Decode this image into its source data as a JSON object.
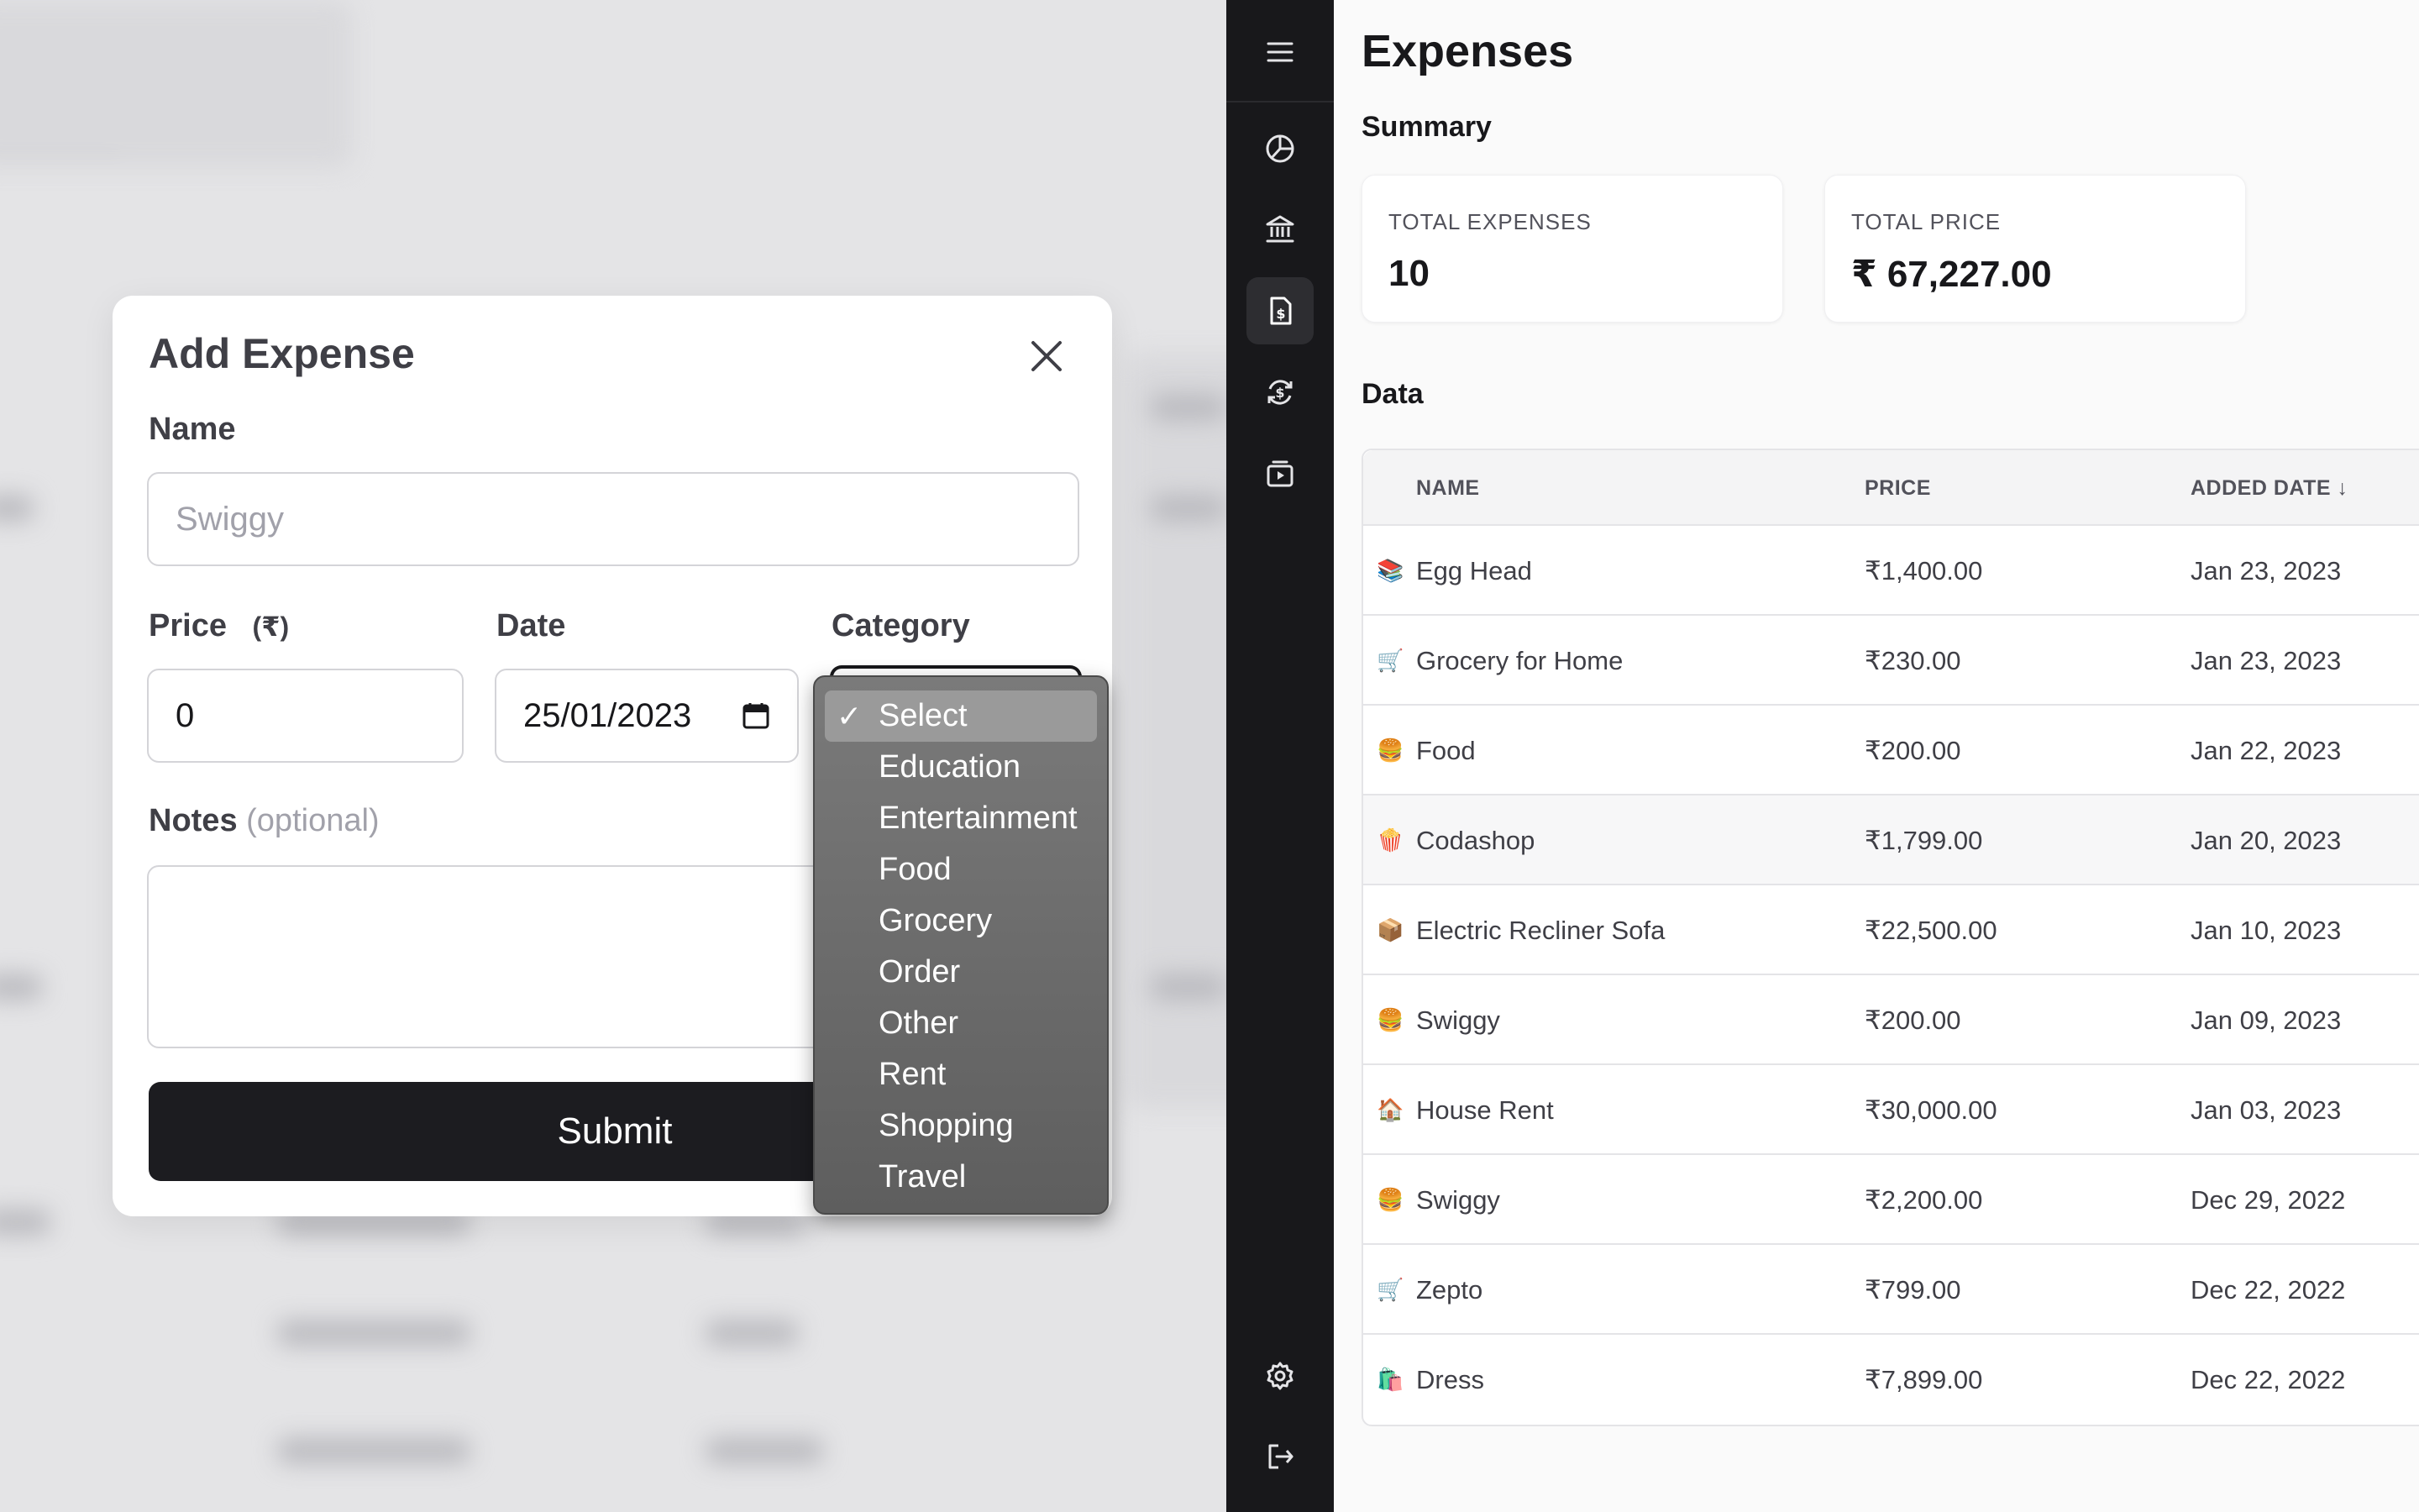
{
  "modal": {
    "title": "Add Expense",
    "name_label": "Name",
    "name_placeholder": "Swiggy",
    "price_label": "Price",
    "price_unit": "(₹)",
    "price_value": "0",
    "date_label": "Date",
    "date_value": "25/01/2023",
    "category_label": "Category",
    "notes_label": "Notes",
    "notes_optional": "(optional)",
    "submit_label": "Submit"
  },
  "dropdown": {
    "check": "✓",
    "options": [
      "Select",
      "Education",
      "Entertainment",
      "Food",
      "Grocery",
      "Order",
      "Other",
      "Rent",
      "Shopping",
      "Travel"
    ]
  },
  "sidebar": {
    "icons": [
      "menu-icon",
      "pie-chart-icon",
      "bank-icon",
      "invoice-icon",
      "recurring-icon",
      "subscription-icon",
      "settings-icon",
      "logout-icon"
    ],
    "active": "invoice-icon"
  },
  "main": {
    "title": "Expenses",
    "summary_title": "Summary",
    "cards": [
      {
        "label": "TOTAL EXPENSES",
        "value": "10"
      },
      {
        "label": "TOTAL PRICE",
        "value": "₹ 67,227.00"
      }
    ],
    "data_title": "Data",
    "table": {
      "headers": {
        "name": "NAME",
        "price": "PRICE",
        "date": "ADDED DATE ↓"
      },
      "rows": [
        {
          "emoji": "📚",
          "name": "Egg Head",
          "price": "₹1,400.00",
          "date": "Jan 23, 2023"
        },
        {
          "emoji": "🛒",
          "name": "Grocery for Home",
          "price": "₹230.00",
          "date": "Jan 23, 2023"
        },
        {
          "emoji": "🍔",
          "name": "Food",
          "price": "₹200.00",
          "date": "Jan 22, 2023"
        },
        {
          "emoji": "🍿",
          "name": "Codashop",
          "price": "₹1,799.00",
          "date": "Jan 20, 2023"
        },
        {
          "emoji": "📦",
          "name": "Electric Recliner Sofa",
          "price": "₹22,500.00",
          "date": "Jan 10, 2023"
        },
        {
          "emoji": "🍔",
          "name": "Swiggy",
          "price": "₹200.00",
          "date": "Jan 09, 2023"
        },
        {
          "emoji": "🏠",
          "name": "House Rent",
          "price": "₹30,000.00",
          "date": "Jan 03, 2023"
        },
        {
          "emoji": "🍔",
          "name": "Swiggy",
          "price": "₹2,200.00",
          "date": "Dec 29, 2022"
        },
        {
          "emoji": "🛒",
          "name": "Zepto",
          "price": "₹799.00",
          "date": "Dec 22, 2022"
        },
        {
          "emoji": "🛍️",
          "name": "Dress",
          "price": "₹7,899.00",
          "date": "Dec 22, 2022"
        }
      ]
    }
  },
  "colors": {
    "sidebar_bg": "#18181b",
    "primary_button": "#1c1c20",
    "page_bg": "#fafafa"
  }
}
